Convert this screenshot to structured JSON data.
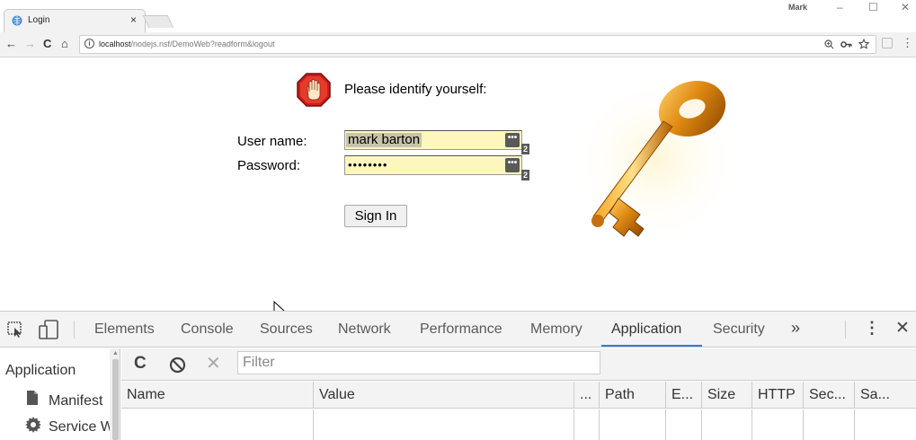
{
  "browser": {
    "tab_title": "Login",
    "tab_close": "×",
    "profile_name": "Mark",
    "window_controls": [
      "–",
      "☐",
      "✕"
    ],
    "nav": {
      "back": "←",
      "forward": "→",
      "reload": "C",
      "home": "⌂"
    },
    "url_host": "localhost",
    "url_path": "/nodejs.nsf/DemoWeb?readform&logout",
    "omnibox_icons": [
      "zoom-icon",
      "key-icon",
      "star-icon"
    ]
  },
  "page": {
    "prompt": "Please identify yourself:",
    "user_label": "User name:",
    "password_label": "Password:",
    "user_value": "mark barton",
    "password_value": "••••••••",
    "password_manager_count": "2",
    "signin_label": "Sign In"
  },
  "devtools": {
    "tabs": [
      {
        "label": "Elements"
      },
      {
        "label": "Console"
      },
      {
        "label": "Sources"
      },
      {
        "label": "Network"
      },
      {
        "label": "Performance"
      },
      {
        "label": "Memory"
      },
      {
        "label": "Application",
        "active": true
      },
      {
        "label": "Security"
      }
    ],
    "more_tabs": "»",
    "kebab": "⋮",
    "close": "✕",
    "sidebar": {
      "heading": "Application",
      "items": [
        {
          "label": "Manifest",
          "icon": "file-icon"
        },
        {
          "label": "Service W",
          "icon": "gear-icon"
        }
      ]
    },
    "filter_placeholder": "Filter",
    "columns": [
      "Name",
      "Value",
      "...",
      "Path",
      "E...",
      "Size",
      "HTTP",
      "Sec...",
      "Sa..."
    ],
    "accent_color": "#3879d9"
  }
}
